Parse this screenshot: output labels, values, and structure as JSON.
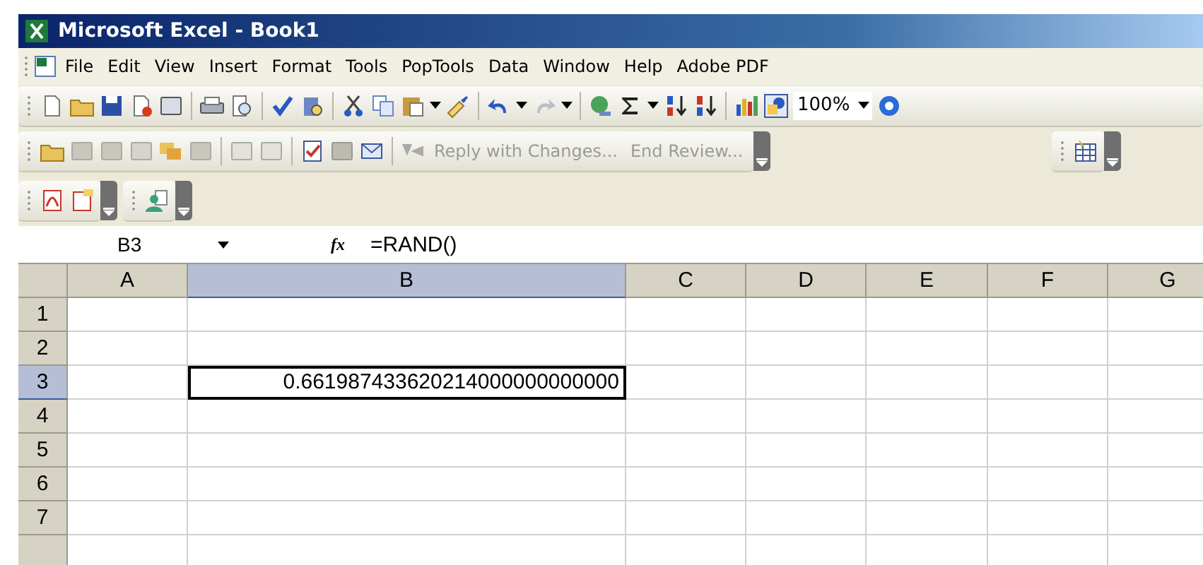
{
  "window": {
    "title": "Microsoft Excel - Book1"
  },
  "menu": [
    "File",
    "Edit",
    "View",
    "Insert",
    "Format",
    "Tools",
    "PopTools",
    "Data",
    "Window",
    "Help",
    "Adobe PDF"
  ],
  "standard_toolbar": {
    "zoom": "100%"
  },
  "reviewing_toolbar": {
    "buttons": [
      {
        "label": "Reply with Changes...",
        "disabled": true
      },
      {
        "label": "End Review...",
        "disabled": true
      }
    ]
  },
  "formula_bar": {
    "name_box": "B3",
    "function_label": "fx",
    "formula": "=RAND()"
  },
  "sheet": {
    "columns": [
      {
        "label": "A",
        "selected": false
      },
      {
        "label": "B",
        "selected": true
      },
      {
        "label": "C",
        "selected": false
      },
      {
        "label": "D",
        "selected": false
      },
      {
        "label": "E",
        "selected": false
      },
      {
        "label": "F",
        "selected": false
      },
      {
        "label": "G",
        "selected": false
      }
    ],
    "rows": [
      {
        "label": "1",
        "selected": false
      },
      {
        "label": "2",
        "selected": false
      },
      {
        "label": "3",
        "selected": true,
        "cells": [
          {
            "kind": "empty"
          },
          {
            "kind": "number",
            "value": "0.661987433620214000000000000",
            "active": true
          }
        ]
      },
      {
        "label": "4",
        "selected": false
      },
      {
        "label": "5",
        "selected": false
      },
      {
        "label": "6",
        "selected": false
      },
      {
        "label": "7",
        "selected": false
      }
    ]
  }
}
